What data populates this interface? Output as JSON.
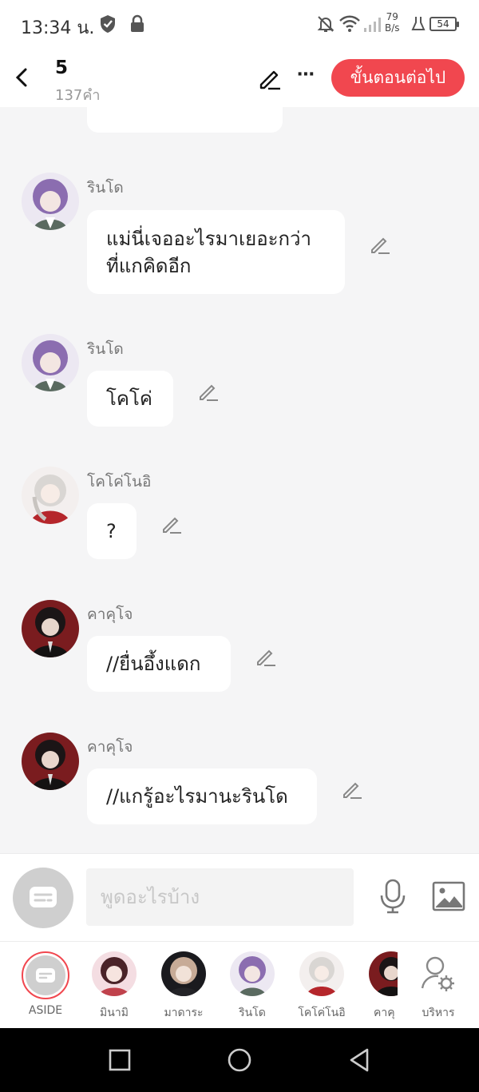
{
  "status_bar": {
    "time": "13:34 น.",
    "net_speed_value": "79",
    "net_speed_unit": "B/s",
    "battery": "54"
  },
  "header": {
    "chapter_title": "5",
    "word_count": "137คำ",
    "next_button": "ขั้นตอนต่อไป"
  },
  "messages": [
    {
      "sender": "รินโด",
      "text_lines": [
        "แม่นี่เจออะไรมาเยอะกว่า",
        "ที่แกคิดอีก"
      ]
    },
    {
      "sender": "รินโด",
      "text_lines": [
        "โคโค่"
      ]
    },
    {
      "sender": "โคโค่โนอิ",
      "text_lines": [
        "?"
      ]
    },
    {
      "sender": "คาคุโจ",
      "text_lines": [
        "//ยื่นอึ้งแดก"
      ]
    },
    {
      "sender": "คาคุโจ",
      "text_lines": [
        "//แกรู้อะไรมานะรินโด"
      ]
    }
  ],
  "input": {
    "placeholder": "พูดอะไรบ้าง"
  },
  "characters": [
    {
      "name": "ASIDE"
    },
    {
      "name": "มินามิ"
    },
    {
      "name": "มาดาระ"
    },
    {
      "name": "รินโด"
    },
    {
      "name": "โคโค่โนอิ"
    },
    {
      "name": "คาคุ"
    },
    {
      "name": "บริหาร"
    }
  ],
  "colors": {
    "accent": "#f1474f",
    "background": "#f5f5f6"
  }
}
